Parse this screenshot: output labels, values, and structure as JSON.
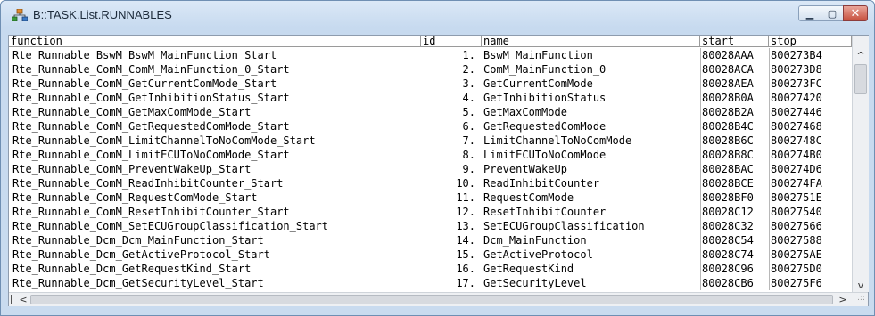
{
  "window": {
    "title": "B::TASK.List.RUNNABLES",
    "app_icon": "runnables-tree-icon"
  },
  "columns": {
    "function": "function",
    "id": "id",
    "name": "name",
    "start": "start",
    "stop": "stop"
  },
  "rows": [
    {
      "function": "Rte_Runnable_BswM_BswM_MainFunction_Start",
      "id": "1.",
      "name": "BswM_MainFunction",
      "start": "80028AAA",
      "stop": "800273B4"
    },
    {
      "function": "Rte_Runnable_ComM_ComM_MainFunction_0_Start",
      "id": "2.",
      "name": "ComM_MainFunction_0",
      "start": "80028ACA",
      "stop": "800273D8"
    },
    {
      "function": "Rte_Runnable_ComM_GetCurrentComMode_Start",
      "id": "3.",
      "name": "GetCurrentComMode",
      "start": "80028AEA",
      "stop": "800273FC"
    },
    {
      "function": "Rte_Runnable_ComM_GetInhibitionStatus_Start",
      "id": "4.",
      "name": "GetInhibitionStatus",
      "start": "80028B0A",
      "stop": "80027420"
    },
    {
      "function": "Rte_Runnable_ComM_GetMaxComMode_Start",
      "id": "5.",
      "name": "GetMaxComMode",
      "start": "80028B2A",
      "stop": "80027446"
    },
    {
      "function": "Rte_Runnable_ComM_GetRequestedComMode_Start",
      "id": "6.",
      "name": "GetRequestedComMode",
      "start": "80028B4C",
      "stop": "80027468"
    },
    {
      "function": "Rte_Runnable_ComM_LimitChannelToNoComMode_Start",
      "id": "7.",
      "name": "LimitChannelToNoComMode",
      "start": "80028B6C",
      "stop": "8002748C"
    },
    {
      "function": "Rte_Runnable_ComM_LimitECUToNoComMode_Start",
      "id": "8.",
      "name": "LimitECUToNoComMode",
      "start": "80028B8C",
      "stop": "800274B0"
    },
    {
      "function": "Rte_Runnable_ComM_PreventWakeUp_Start",
      "id": "9.",
      "name": "PreventWakeUp",
      "start": "80028BAC",
      "stop": "800274D6"
    },
    {
      "function": "Rte_Runnable_ComM_ReadInhibitCounter_Start",
      "id": "10.",
      "name": "ReadInhibitCounter",
      "start": "80028BCE",
      "stop": "800274FA"
    },
    {
      "function": "Rte_Runnable_ComM_RequestComMode_Start",
      "id": "11.",
      "name": "RequestComMode",
      "start": "80028BF0",
      "stop": "8002751E"
    },
    {
      "function": "Rte_Runnable_ComM_ResetInhibitCounter_Start",
      "id": "12.",
      "name": "ResetInhibitCounter",
      "start": "80028C12",
      "stop": "80027540"
    },
    {
      "function": "Rte_Runnable_ComM_SetECUGroupClassification_Start",
      "id": "13.",
      "name": "SetECUGroupClassification",
      "start": "80028C32",
      "stop": "80027566"
    },
    {
      "function": "Rte_Runnable_Dcm_Dcm_MainFunction_Start",
      "id": "14.",
      "name": "Dcm_MainFunction",
      "start": "80028C54",
      "stop": "80027588"
    },
    {
      "function": "Rte_Runnable_Dcm_GetActiveProtocol_Start",
      "id": "15.",
      "name": "GetActiveProtocol",
      "start": "80028C74",
      "stop": "800275AE"
    },
    {
      "function": "Rte_Runnable_Dcm_GetRequestKind_Start",
      "id": "16.",
      "name": "GetRequestKind",
      "start": "80028C96",
      "stop": "800275D0"
    },
    {
      "function": "Rte_Runnable_Dcm_GetSecurityLevel_Start",
      "id": "17.",
      "name": "GetSecurityLevel",
      "start": "80028CB6",
      "stop": "800275F6"
    }
  ],
  "controls": {
    "minimize_glyph": "▁",
    "maximize_glyph": "▢",
    "close_glyph": "✕",
    "scroll_up": "^",
    "scroll_down": "v",
    "scroll_left": "<",
    "scroll_right": ">",
    "grip": ".::"
  }
}
